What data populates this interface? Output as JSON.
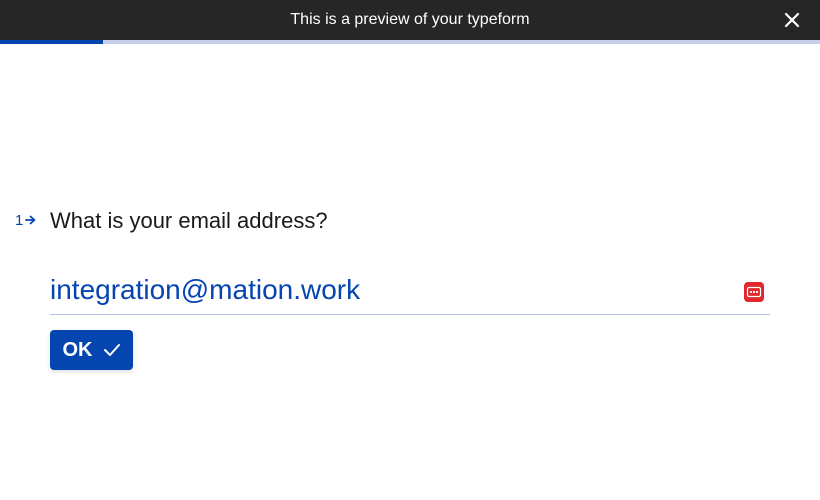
{
  "preview_bar": {
    "message": "This is a preview of your typeform",
    "close_icon": "close-icon",
    "background": "#262626"
  },
  "progress": {
    "fraction": 0.125,
    "fill_color": "#0445af",
    "track_color": "#c5cfe8"
  },
  "question": {
    "number": "1",
    "arrow_icon": "arrow-right-icon",
    "text": "What is your email address?"
  },
  "answer": {
    "value": "integration@mation.work",
    "password_manager_icon": "password-manager-icon",
    "accent": "#0445af"
  },
  "submit": {
    "label": "OK",
    "icon": "checkmark-icon"
  }
}
